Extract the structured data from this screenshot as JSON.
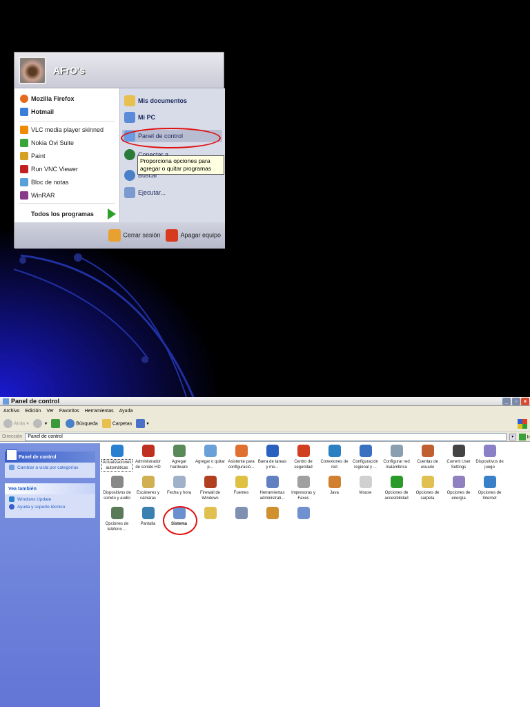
{
  "start_menu": {
    "user": "AFrO's",
    "pinned": [
      {
        "label": "Mozilla Firefox",
        "color": "#e66a1e"
      },
      {
        "label": "Hotmail",
        "color": "#3b7dd8"
      }
    ],
    "recent": [
      {
        "label": "VLC media player skinned",
        "color": "#f08a00"
      },
      {
        "label": "Nokia Ovi Suite",
        "color": "#3aa63a"
      },
      {
        "label": "Paint",
        "color": "#d6a020"
      },
      {
        "label": "Run VNC Viewer",
        "color": "#c02020"
      },
      {
        "label": "Bloc de notas",
        "color": "#5aa0d8"
      },
      {
        "label": "WinRAR",
        "color": "#8a3a8a"
      }
    ],
    "all_programs": "Todos los programas",
    "right": [
      {
        "label": "Mis documentos",
        "bold": true,
        "color": "#e8c050"
      },
      {
        "label": "Mi PC",
        "bold": true,
        "color": "#5a8ad8"
      },
      {
        "label": "Panel de control",
        "bold": false,
        "color": "#6a9ae0"
      },
      {
        "label": "Conectar a",
        "bold": false,
        "color": "#2a7a3a"
      },
      {
        "label": "Buscar",
        "bold": false,
        "color": "#4a80c8"
      },
      {
        "label": "Ejecutar...",
        "bold": false,
        "color": "#7a9ad0"
      }
    ],
    "tooltip": [
      "Proporciona opciones para",
      "agregar o quitar programas"
    ],
    "logoff": "Cerrar sesión",
    "shutdown": "Apagar equipo"
  },
  "window": {
    "title": "Panel de control",
    "menu": [
      "Archivo",
      "Edición",
      "Ver",
      "Favoritos",
      "Herramientas",
      "Ayuda"
    ],
    "toolbar": {
      "back": "Atrás",
      "search": "Búsqueda",
      "folders": "Carpetas"
    },
    "address_label": "Dirección",
    "address": "Panel de control",
    "go": "Ir",
    "side": {
      "panel_title": "Panel de control",
      "switch": "Cambiar a vista por categorías",
      "see_also": "Vea también",
      "links": [
        "Windows Update",
        "Ayuda y soporte técnico"
      ]
    },
    "items": [
      {
        "label": "Actualizaciones automáticas",
        "color": "#2a80d0"
      },
      {
        "label": "Administrador de sonido HD",
        "color": "#c03020"
      },
      {
        "label": "Agregar hardware",
        "color": "#5a8a5a"
      },
      {
        "label": "Agregar o quitar p...",
        "color": "#6aa0d8"
      },
      {
        "label": "Asistente para configuració...",
        "color": "#e07030"
      },
      {
        "label": "Barra de tareas y me...",
        "color": "#2a60c0"
      },
      {
        "label": "Centro de seguridad",
        "color": "#d04020"
      },
      {
        "label": "Conexiones de red",
        "color": "#2a80c0"
      },
      {
        "label": "Configuración regional y ...",
        "color": "#3a70c0"
      },
      {
        "label": "Configurar red inalámbrica",
        "color": "#8aa0b0"
      },
      {
        "label": "Cuentas de usuario",
        "color": "#c06030"
      },
      {
        "label": "Current User Settings",
        "color": "#444444"
      },
      {
        "label": "Dispositivos de juego",
        "color": "#8a80c8"
      },
      {
        "label": "Dispositivos de sonido y audio",
        "color": "#888888"
      },
      {
        "label": "Escáneres y cámaras",
        "color": "#d0b050"
      },
      {
        "label": "Fecha y hora",
        "color": "#a0b0c8"
      },
      {
        "label": "Firewall de Windows",
        "color": "#b04020"
      },
      {
        "label": "Fuentes",
        "color": "#e0c040"
      },
      {
        "label": "Herramientas administrati...",
        "color": "#6080c0"
      },
      {
        "label": "Impresoras y Faxes",
        "color": "#a0a0a0"
      },
      {
        "label": "Java",
        "color": "#d08030"
      },
      {
        "label": "Mouse",
        "color": "#d0d0d0"
      },
      {
        "label": "Opciones de accesibilidad",
        "color": "#2a9a2a"
      },
      {
        "label": "Opciones de carpeta",
        "color": "#e0c050"
      },
      {
        "label": "Opciones de energía",
        "color": "#9080c0"
      },
      {
        "label": "Opciones de Internet",
        "color": "#3a80c8"
      },
      {
        "label": "Opciones de teléfono ...",
        "color": "#5a7a5a"
      },
      {
        "label": "Pantalla",
        "color": "#3a80b0"
      },
      {
        "label": "Sistema",
        "color": "#6a90d0"
      },
      {
        "label": "",
        "color": "#e0c050"
      },
      {
        "label": "",
        "color": "#8090b0"
      },
      {
        "label": "",
        "color": "#d09030"
      },
      {
        "label": "",
        "color": "#7090d0"
      }
    ]
  }
}
